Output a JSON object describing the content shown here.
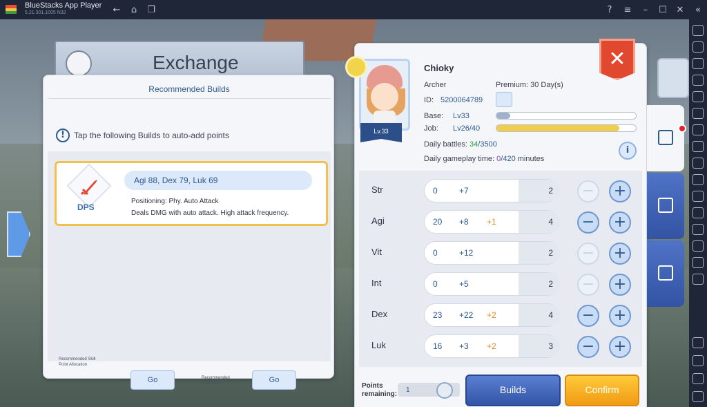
{
  "titlebar": {
    "app_title": "BlueStacks App Player",
    "version": "5.21.301.1005  N32",
    "icons": [
      "back-icon",
      "home-icon",
      "recent-apps-icon",
      "help-icon",
      "menu-icon",
      "minimize-icon",
      "maximize-icon",
      "close-icon",
      "collapse-sidebar-icon"
    ]
  },
  "exchange": {
    "title": "Exchange"
  },
  "recommended": {
    "title": "Recommended Builds",
    "hint": "Tap the following Builds to auto-add points",
    "builds": [
      {
        "role": "DPS",
        "stats": "Agi 88, Dex 79, Luk 69",
        "positioning": "Positioning: Phy. Auto Attack",
        "description": "Deals DMG with auto attack. High attack frequency."
      }
    ],
    "footer": {
      "skill_label": "Recommended Skill Point Allocation",
      "equipment_label": "Recommended Equipment",
      "go_label": "Go"
    }
  },
  "character": {
    "name": "Chioky",
    "class": "Archer",
    "premium": "Premium: 30 Day(s)",
    "id_label": "ID:",
    "id": "5200064789",
    "level_badge": "Lv.33",
    "base_label": "Base:",
    "base_level": "Lv33",
    "base_progress": 0.1,
    "job_label": "Job:",
    "job_level": "Lv26/40",
    "job_progress": 0.88,
    "daily_battles_label": "Daily battles:",
    "daily_battles_current": "34",
    "daily_battles_max": "/3500",
    "daily_time_label": "Daily gameplay time:",
    "daily_time_current": "0",
    "daily_time_max": "/420",
    "daily_time_unit": "minutes",
    "info_label": "i"
  },
  "stats": [
    {
      "name": "Str",
      "base": "0",
      "bonus": "+7",
      "extra": "",
      "cost": "2",
      "minus_enabled": false,
      "plus_enabled": true
    },
    {
      "name": "Agi",
      "base": "20",
      "bonus": "+8",
      "extra": "+1",
      "cost": "4",
      "minus_enabled": true,
      "plus_enabled": true
    },
    {
      "name": "Vit",
      "base": "0",
      "bonus": "+12",
      "extra": "",
      "cost": "2",
      "minus_enabled": false,
      "plus_enabled": true
    },
    {
      "name": "Int",
      "base": "0",
      "bonus": "+5",
      "extra": "",
      "cost": "2",
      "minus_enabled": false,
      "plus_enabled": true
    },
    {
      "name": "Dex",
      "base": "23",
      "bonus": "+22",
      "extra": "+2",
      "cost": "4",
      "minus_enabled": true,
      "plus_enabled": true
    },
    {
      "name": "Luk",
      "base": "16",
      "bonus": "+3",
      "extra": "+2",
      "cost": "3",
      "minus_enabled": true,
      "plus_enabled": true
    }
  ],
  "footer": {
    "points_label_line1": "Points",
    "points_label_line2": "remaining:",
    "points_value": "1",
    "builds_label": "Builds",
    "confirm_label": "Confirm"
  },
  "close_label": "✕",
  "colors": {
    "accent_blue": "#2f5a8f",
    "confirm_orange": "#f09a14",
    "close_red": "#e0482f",
    "bonus_orange": "#e08b2a"
  }
}
